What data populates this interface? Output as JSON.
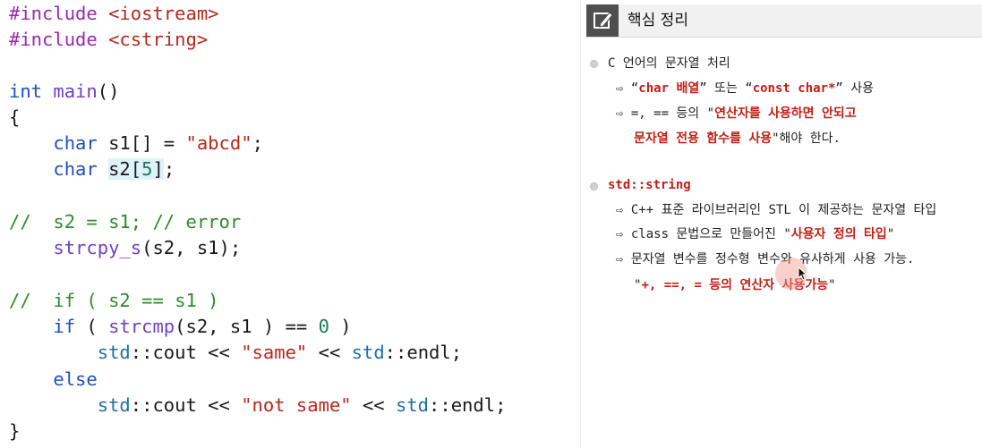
{
  "code": {
    "include1": [
      "#include",
      " ",
      "<iostream>"
    ],
    "include2": [
      "#include",
      " ",
      "<cstring>"
    ],
    "main_sig": [
      "int",
      " ",
      "main",
      "()"
    ],
    "brace_open": "{",
    "decl1": [
      "    ",
      "char",
      " s1[] = ",
      "\"abcd\"",
      ";"
    ],
    "decl2": [
      "    ",
      "char",
      " ",
      "s2[",
      "5",
      "]",
      ";"
    ],
    "comment1": "//  s2 = s1; // error",
    "strcpy": [
      "    ",
      "strcpy_s",
      "(s2, s1);"
    ],
    "comment2": "//  if ( s2 == s1 )",
    "if_line": [
      "    ",
      "if",
      " ( ",
      "strcmp",
      "(s2, s1 ) == ",
      "0",
      " )"
    ],
    "cout_same": [
      "        ",
      "std",
      "::cout << ",
      "\"same\"",
      " << ",
      "std",
      "::endl;"
    ],
    "else_line": [
      "    ",
      "else"
    ],
    "cout_not": [
      "        ",
      "std",
      "::cout << ",
      "\"not same\"",
      " << ",
      "std",
      "::endl;"
    ],
    "brace_close": "}"
  },
  "notes": {
    "icon": "edit-icon",
    "title": "핵심 정리",
    "section1": {
      "heading": "C 언어의 문자열 처리",
      "item1": [
        "⇨ ",
        "“",
        "char 배열",
        "” 또는 “",
        "const char*",
        "” 사용"
      ],
      "item2_line1": [
        "⇨ =, == 등의 ",
        "\"",
        "연산자를 사용하면 안되고"
      ],
      "item2_line2": [
        "문자열 전용 함수를 사용",
        "\"해야 한다."
      ]
    },
    "section2": {
      "heading": "std::string",
      "item1": "⇨ C++ 표준 라이브러리인 STL 이 제공하는 문자열 타입",
      "item2": [
        "⇨ class 문법으로 만들어진 ",
        "\"",
        "사용자 정의 타입",
        "\""
      ],
      "item3": "⇨ 문자열 변수를 정수형 변수와 유사하게 사용 가능.",
      "item4": [
        "\"",
        "+, ==, = 등의 연산자 사용가능",
        "\""
      ]
    }
  },
  "colors": {
    "keyword": "#1f4fbf",
    "preprocessor": "#9c27b0",
    "string": "#b8271b",
    "comment": "#2e8b2e",
    "number": "#1b7a5a",
    "emphasis": "#c21e14"
  }
}
